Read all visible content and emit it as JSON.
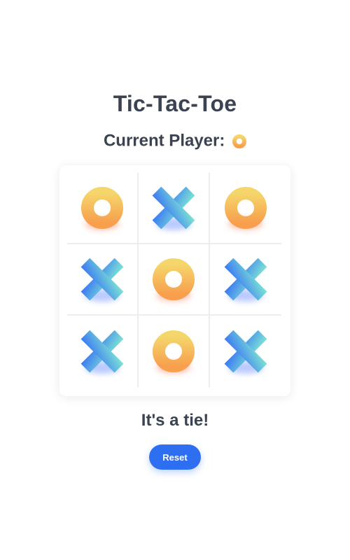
{
  "game": {
    "title": "Tic-Tac-Toe",
    "current_player_label": "Current Player:",
    "current_player": "O",
    "status": "It's a tie!",
    "reset_label": "Reset"
  },
  "board": [
    "O",
    "X",
    "O",
    "X",
    "O",
    "X",
    "X",
    "O",
    "X"
  ],
  "colors": {
    "text": "#3b4350",
    "accent": "#2e6ff2",
    "o_gradient": [
      "#f5d66b",
      "#f79f4d"
    ],
    "x_gradient": [
      "#7de3d4",
      "#3b79f3"
    ],
    "grid_line": "#ebedf0"
  },
  "icons": {
    "O": "ring-o-icon",
    "X": "cross-x-icon"
  }
}
